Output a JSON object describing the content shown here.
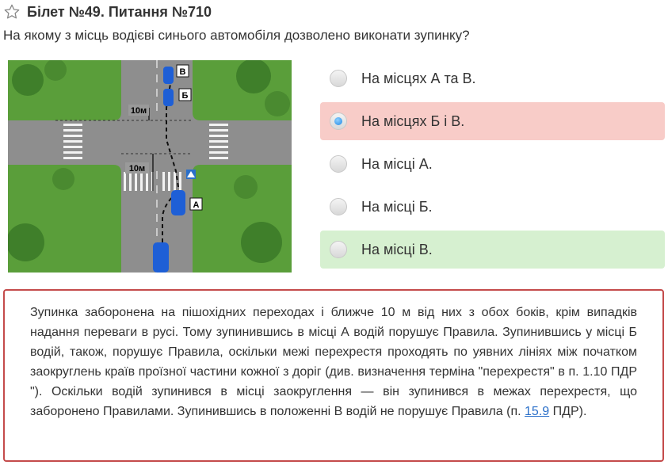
{
  "header": {
    "star_icon": "star-outline-icon",
    "title": "Білет №49. Питання №710"
  },
  "question": "На якому з місць водієві синього автомобіля дозволено виконати зупинку?",
  "illustration": {
    "labels": {
      "a": "А",
      "b": "Б",
      "v": "В"
    },
    "distance_labels": [
      "10м",
      "10м"
    ]
  },
  "answers": [
    {
      "label": "На місцях А та В.",
      "state": "neutral",
      "selected": false
    },
    {
      "label": "На місцях Б і В.",
      "state": "wrong",
      "selected": true
    },
    {
      "label": "На місці А.",
      "state": "neutral",
      "selected": false
    },
    {
      "label": "На місці Б.",
      "state": "neutral",
      "selected": false
    },
    {
      "label": "На місці В.",
      "state": "correct",
      "selected": false
    }
  ],
  "explanation": {
    "text_before_link": "Зупинка заборонена на пішохідних переходах і ближче 10 м від них з обох боків, крім випадків надання переваги в русі. Тому зупинившись в місці А водій порушує Правила. Зупинившись у місці Б водій, також, порушує Правила, оскільки межі перехрестя проходять по уявних лініях між початком заокруглень країв проїзної частини кожної з доріг (див. визначення терміна \"перехрестя\" в п. 1.10 ПДР \"). Оскільки водій зупинився в місці заокруглення — він зупинився в межах перехрестя, що заборонено Правилами. Зупинившись в положенні В водій не порушує Правила (п. ",
    "link_text": "15.9",
    "text_after_link": " ПДР)."
  },
  "colors": {
    "wrong_bg": "#f8ccc8",
    "correct_bg": "#d6f0d0",
    "border": "#c44b4b",
    "link": "#2a6fc9"
  }
}
